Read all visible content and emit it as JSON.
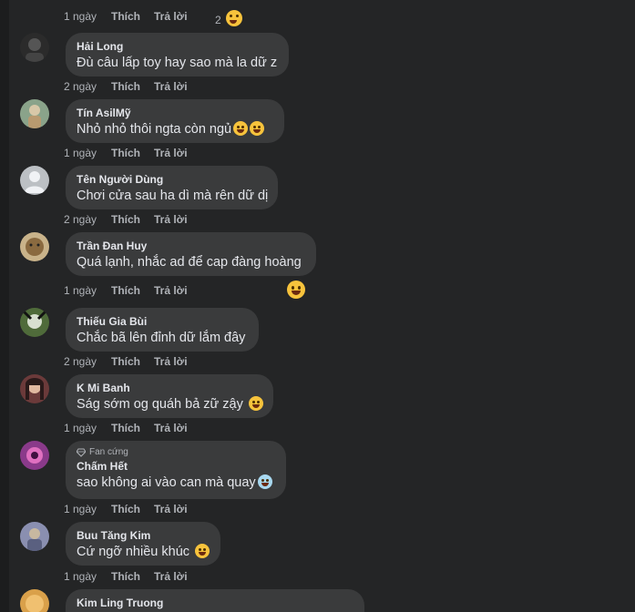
{
  "top_actions": {
    "time": "1 ngày",
    "like": "Thích",
    "reply": "Trả lời",
    "reaction_count": "2"
  },
  "comments": [
    {
      "name": "Hải Long",
      "text": "Đù câu lấp toy hay sao mà la dữ z",
      "time": "2 ngày",
      "like": "Thích",
      "reply": "Trả lời",
      "avatar_color": "#2b2b2b"
    },
    {
      "name": "Tín AsilMỹ",
      "text": "Nhỏ nhỏ thôi ngta còn ngủ",
      "time": "1 ngày",
      "like": "Thích",
      "reply": "Trả lời",
      "avatar_color": "#8aa38a",
      "emoji_count": 2
    },
    {
      "name": "Tên Người Dùng",
      "text": "Chơi cửa sau ha dì mà rên dữ dị",
      "time": "2 ngày",
      "like": "Thích",
      "reply": "Trả lời",
      "avatar_color": "#bcc0c4"
    },
    {
      "name": "Trần Đan Huy",
      "text": "Quá lạnh, nhắc ad để cap đàng hoàng",
      "time": "1 ngày",
      "like": "Thích",
      "reply": "Trả lời",
      "avatar_color": "#c9b38a"
    },
    {
      "name": "Thiếu Gia Bùi",
      "text": "Chắc bã lên đỉnh dữ lắm đây",
      "time": "2 ngày",
      "like": "Thích",
      "reply": "Trả lời",
      "avatar_color": "#4f6b3a"
    },
    {
      "name": "K Mi Banh",
      "text": "Ság sớm og quáh bả zữ zậy",
      "time": "1 ngày",
      "like": "Thích",
      "reply": "Trả lời",
      "avatar_color": "#6b3a3a",
      "emoji_count": 1
    },
    {
      "name": "Chấm Hết",
      "badge": "Fan cứng",
      "text": "sao không ai vào can mà quay",
      "time": "1 ngày",
      "like": "Thích",
      "reply": "Trả lời",
      "avatar_color": "#8a3a8a",
      "emoji_count": 1
    },
    {
      "name": "Buu Tăng Kim",
      "text": "Cứ ngỡ nhiều khúc",
      "time": "1 ngày",
      "like": "Thích",
      "reply": "Trả lời",
      "avatar_color": "#8a8fb0",
      "emoji_count": 1
    },
    {
      "name": "Kim Ling Truong",
      "text": "",
      "avatar_color": "#d9a04a"
    }
  ],
  "colors": {
    "bubble": "#3a3b3c",
    "panel": "#242526",
    "text": "#e4e6eb",
    "muted": "#b0b3b8",
    "emoji": "#f7c33c"
  }
}
